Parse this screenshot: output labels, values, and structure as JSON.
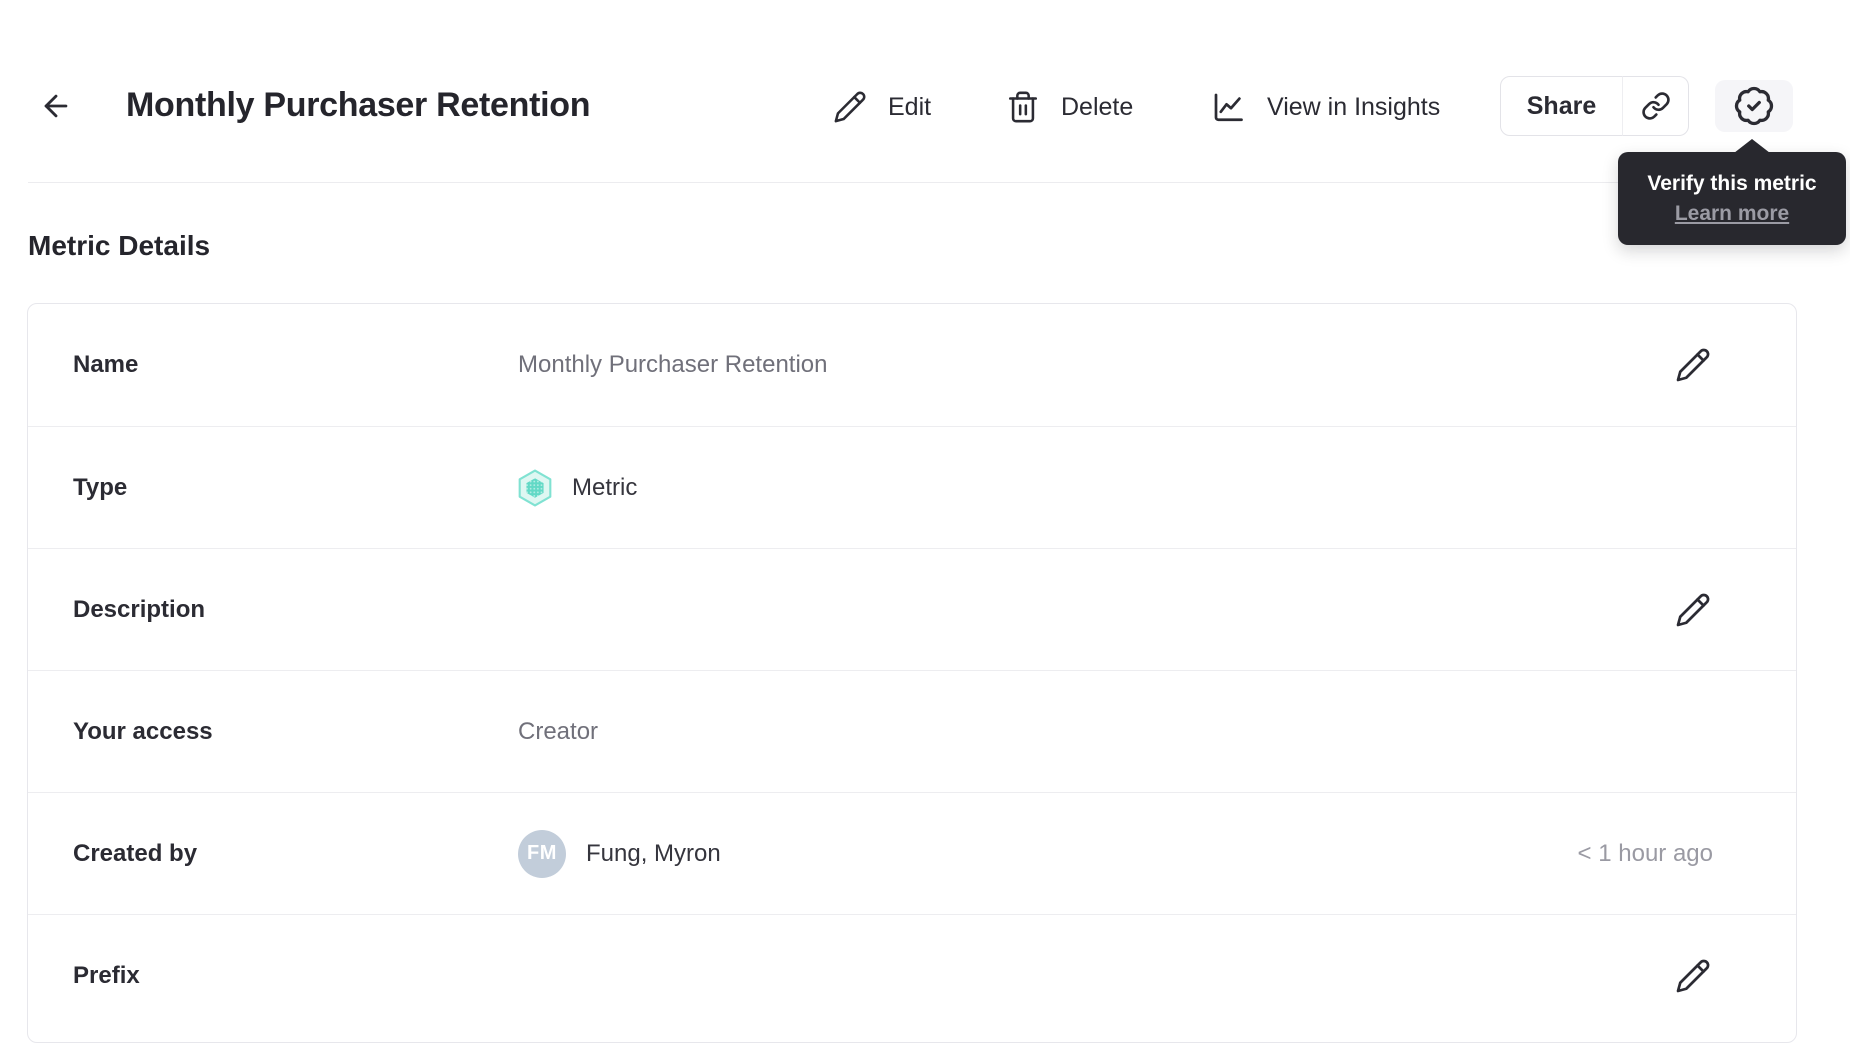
{
  "header": {
    "title": "Monthly Purchaser Retention",
    "actions": {
      "edit_label": "Edit",
      "delete_label": "Delete",
      "insights_label": "View in Insights",
      "share_label": "Share"
    },
    "icons": {
      "back": "arrow-left-icon",
      "edit": "pencil-icon",
      "delete": "trash-icon",
      "insights": "line-chart-icon",
      "copy_link": "link-icon",
      "verify": "verified-badge-icon"
    }
  },
  "tooltip": {
    "title": "Verify this metric",
    "link_label": "Learn more"
  },
  "section": {
    "heading": "Metric Details"
  },
  "details": {
    "rows": [
      {
        "label": "Name",
        "value": "Monthly Purchaser Retention",
        "editable": true
      },
      {
        "label": "Type",
        "value": "Metric",
        "icon": "hexagon-metric-icon",
        "editable": false
      },
      {
        "label": "Description",
        "value": "",
        "editable": true
      },
      {
        "label": "Your access",
        "value": "Creator",
        "editable": false
      },
      {
        "label": "Created by",
        "value": "Fung, Myron",
        "avatar_initials": "FM",
        "meta": "< 1 hour ago",
        "editable": false
      },
      {
        "label": "Prefix",
        "value": "",
        "editable": true
      }
    ]
  },
  "colors": {
    "text_dark": "#2b2b33",
    "text_muted": "#70707a",
    "meta_gray": "#9a9aa3",
    "tooltip_bg": "#28282e",
    "tooltip_link": "#9b9ba4",
    "badge_button_bg": "#f5f5f8",
    "metric_teal_stroke": "#80e2d2",
    "metric_teal_fill": "#def7f2",
    "metric_teal_inner": "#62d9c6",
    "avatar_bg": "#c2cdda",
    "card_border": "#e7e7ec",
    "row_divider": "#ededf0"
  }
}
